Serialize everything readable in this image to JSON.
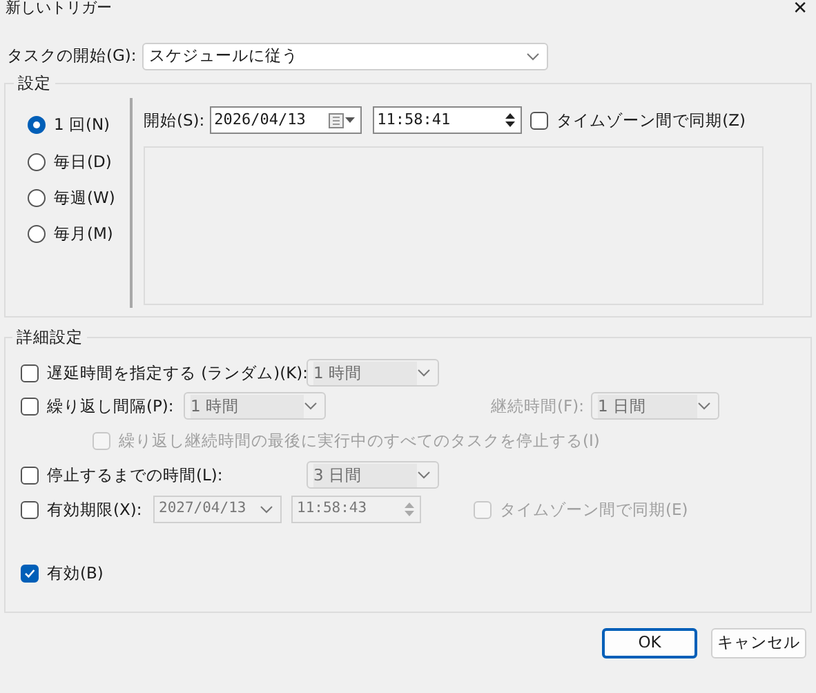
{
  "window": {
    "title": "新しいトリガー",
    "close": "✕"
  },
  "task_start": {
    "label": "タスクの開始(G):",
    "value": "スケジュールに従う"
  },
  "settings": {
    "title": "設定",
    "schedules": [
      {
        "label": "1 回(N)",
        "selected": true
      },
      {
        "label": "毎日(D)",
        "selected": false
      },
      {
        "label": "毎週(W)",
        "selected": false
      },
      {
        "label": "毎月(M)",
        "selected": false
      }
    ],
    "start": {
      "label": "開始(S):",
      "date": "2026/04/13",
      "time": "11:58:41"
    },
    "sync_timezone": {
      "label": "タイムゾーン間で同期(Z)",
      "checked": false
    }
  },
  "advanced": {
    "title": "詳細設定",
    "delay": {
      "label": "遅延時間を指定する (ランダム)(K):",
      "checked": false,
      "value": "1 時間",
      "disabled": true
    },
    "repeat": {
      "label": "繰り返し間隔(P):",
      "checked": false,
      "value": "1 時間",
      "disabled": true,
      "duration_label": "継続時間(F):",
      "duration_value": "1 日間"
    },
    "stop_all": {
      "label": "繰り返し継続時間の最後に実行中のすべてのタスクを停止する(I)",
      "checked": false,
      "disabled": true
    },
    "stop_after": {
      "label": "停止するまでの時間(L):",
      "checked": false,
      "value": "3 日間",
      "disabled": true
    },
    "expire": {
      "label": "有効期限(X):",
      "checked": false,
      "date": "2027/04/13",
      "time": "11:58:43",
      "disabled": true
    },
    "expire_sync": {
      "label": "タイムゾーン間で同期(E)",
      "checked": false,
      "disabled": true
    },
    "enabled": {
      "label": "有効(B)",
      "checked": true
    }
  },
  "buttons": [
    {
      "label": "OK",
      "default": true
    },
    {
      "label": "キャンセル",
      "default": false
    }
  ]
}
